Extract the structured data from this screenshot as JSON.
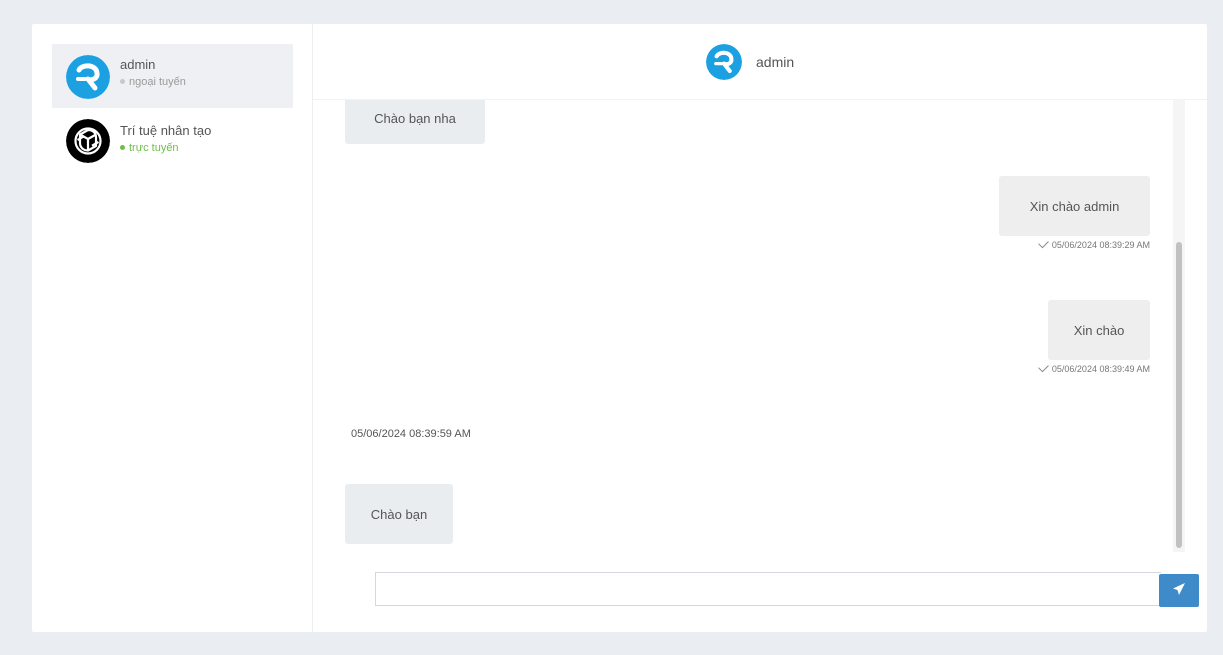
{
  "sidebar": {
    "contacts": [
      {
        "name": "admin",
        "status": "ngoại tuyến",
        "status_type": "offline",
        "avatar_icon": "admin-logo-icon",
        "active": true
      },
      {
        "name": "Trí tuệ nhân tạo",
        "status": "trực tuyến",
        "status_type": "online",
        "avatar_icon": "openai-logo-icon",
        "active": false
      }
    ]
  },
  "chat": {
    "header_title": "admin",
    "messages": [
      {
        "direction": "in",
        "text": "Chào bạn nha"
      },
      {
        "direction": "out",
        "text": "Xin chào admin",
        "time": "05/06/2024 08:39:29 AM"
      },
      {
        "direction": "out",
        "text": "Xin chào",
        "time": "05/06/2024 08:39:49 AM"
      },
      {
        "divider": "05/06/2024 08:39:59 AM"
      },
      {
        "direction": "in",
        "text": "Chào bạn"
      }
    ],
    "composer": {
      "value": "",
      "placeholder": ""
    }
  },
  "colors": {
    "accent": "#3f8bc9",
    "admin_logo": "#1ba1e2",
    "online": "#6cbf4a",
    "background": "#eaeef3"
  }
}
